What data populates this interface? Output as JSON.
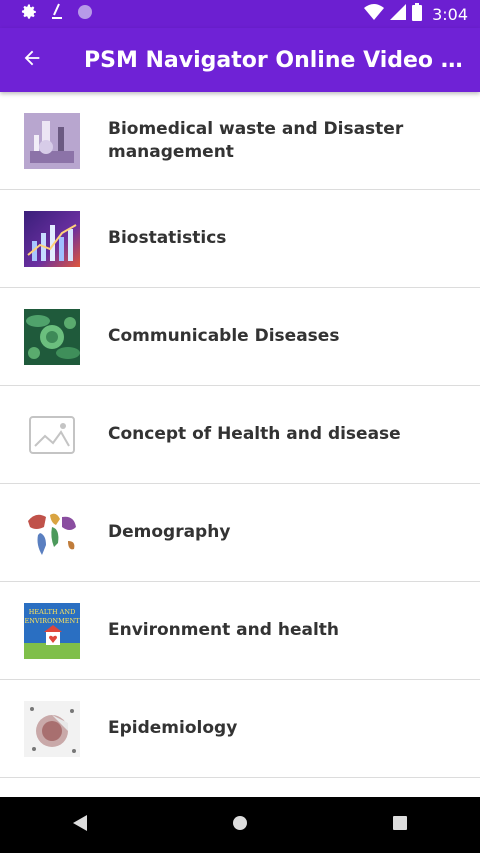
{
  "status_bar": {
    "time": "3:04",
    "icons": [
      "gear-icon",
      "pen-icon",
      "circle-icon",
      "wifi-icon",
      "signal-icon",
      "battery-icon"
    ]
  },
  "toolbar": {
    "title": "PSM Navigator Online Video Lectur...",
    "back_icon": "back-arrow-icon"
  },
  "list": {
    "items": [
      {
        "label": "Biomedical waste and Disaster management",
        "thumb": "lab-image"
      },
      {
        "label": "Biostatistics",
        "thumb": "chart-image"
      },
      {
        "label": "Communicable Diseases",
        "thumb": "virus-image"
      },
      {
        "label": "Concept of Health and disease",
        "thumb": "placeholder-image-icon"
      },
      {
        "label": "Demography",
        "thumb": "world-map-image"
      },
      {
        "label": "Environment and health",
        "thumb": "health-environment-image",
        "thumb_text": "HEALTH AND ENVIRONMENT"
      },
      {
        "label": "Epidemiology",
        "thumb": "crowd-image"
      }
    ]
  },
  "nav_bar": {
    "buttons": [
      "back-triangle-icon",
      "home-circle-icon",
      "recents-square-icon"
    ]
  },
  "colors": {
    "status_bar": "#6c1fd1",
    "toolbar": "#6f22d6",
    "text": "#333333",
    "divider": "#dcdcdc"
  }
}
